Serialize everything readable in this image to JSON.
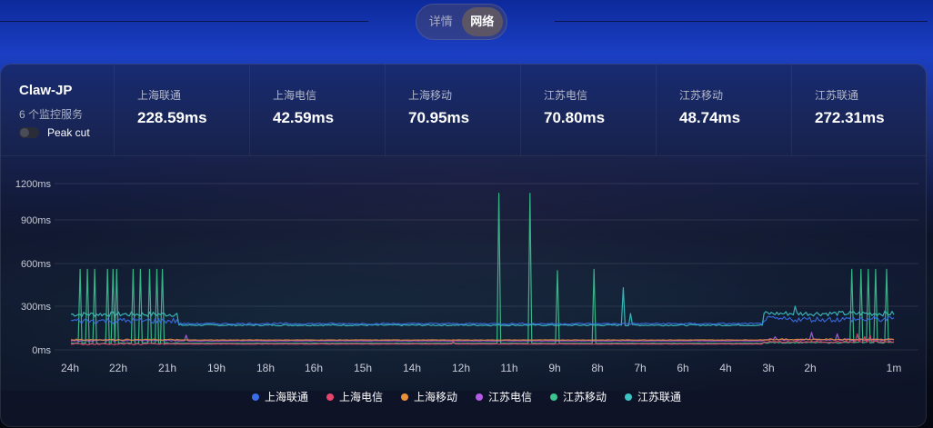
{
  "tabs": {
    "details": "详情",
    "network": "网络",
    "active": "network"
  },
  "server": {
    "name": "Claw-JP",
    "monitor_count": "6 个监控服务"
  },
  "peak_cut": {
    "label": "Peak cut",
    "enabled": false
  },
  "stats": [
    {
      "label": "上海联通",
      "value": "228.59ms"
    },
    {
      "label": "上海电信",
      "value": "42.59ms"
    },
    {
      "label": "上海移动",
      "value": "70.95ms"
    },
    {
      "label": "江苏电信",
      "value": "70.80ms"
    },
    {
      "label": "江苏移动",
      "value": "48.74ms"
    },
    {
      "label": "江苏联通",
      "value": "272.31ms"
    }
  ],
  "chart_data": {
    "type": "line",
    "yticks": [
      "0ms",
      "300ms",
      "600ms",
      "900ms",
      "1200ms"
    ],
    "ytick_values": [
      0,
      300,
      600,
      900,
      1200
    ],
    "ylim": [
      0,
      1200
    ],
    "xticks": [
      "24h",
      "22h",
      "21h",
      "19h",
      "18h",
      "16h",
      "15h",
      "14h",
      "12h",
      "11h",
      "9h",
      "8h",
      "7h",
      "6h",
      "4h",
      "3h",
      "2h",
      "1m"
    ],
    "grid": true,
    "legend_position": "bottom",
    "series": [
      {
        "name": "上海联通",
        "color": "#3a6ee8",
        "baseline": 180,
        "early_level": 200,
        "late_level": 210,
        "noise": 14
      },
      {
        "name": "上海电信",
        "color": "#e8446e",
        "baseline": 40,
        "early_level": 40,
        "late_level": 55,
        "noise": 4,
        "spikes": [
          [
            0.465,
            60
          ],
          [
            0.955,
            110
          ],
          [
            0.965,
            90
          ],
          [
            0.97,
            100
          ]
        ]
      },
      {
        "name": "上海移动",
        "color": "#e8913a",
        "baseline": 68,
        "early_level": 70,
        "late_level": 72,
        "noise": 3
      },
      {
        "name": "江苏电信",
        "color": "#b45ce8",
        "baseline": 62,
        "early_level": 65,
        "late_level": 70,
        "noise": 4,
        "spikes": [
          [
            0.14,
            100
          ],
          [
            0.855,
            90
          ],
          [
            0.9,
            120
          ],
          [
            0.93,
            110
          ]
        ]
      },
      {
        "name": "江苏移动",
        "color": "#3cc48e",
        "baseline": 45,
        "early_level": 45,
        "late_level": 50,
        "noise": 3,
        "spikes": [
          [
            0.012,
            560
          ],
          [
            0.02,
            560
          ],
          [
            0.028,
            560
          ],
          [
            0.045,
            560
          ],
          [
            0.05,
            560
          ],
          [
            0.055,
            560
          ],
          [
            0.075,
            560
          ],
          [
            0.085,
            560
          ],
          [
            0.095,
            560
          ],
          [
            0.105,
            560
          ],
          [
            0.11,
            560
          ],
          [
            0.52,
            1120
          ],
          [
            0.558,
            1120
          ],
          [
            0.59,
            550
          ],
          [
            0.635,
            560
          ],
          [
            0.948,
            560
          ],
          [
            0.96,
            560
          ],
          [
            0.968,
            560
          ],
          [
            0.978,
            560
          ],
          [
            0.99,
            560
          ]
        ]
      },
      {
        "name": "江苏联通",
        "color": "#3cc4c4",
        "baseline": 170,
        "early_level": 245,
        "late_level": 250,
        "noise": 12,
        "spikes": [
          [
            0.67,
            430
          ],
          [
            0.68,
            250
          ],
          [
            0.88,
            300
          ]
        ]
      }
    ]
  }
}
